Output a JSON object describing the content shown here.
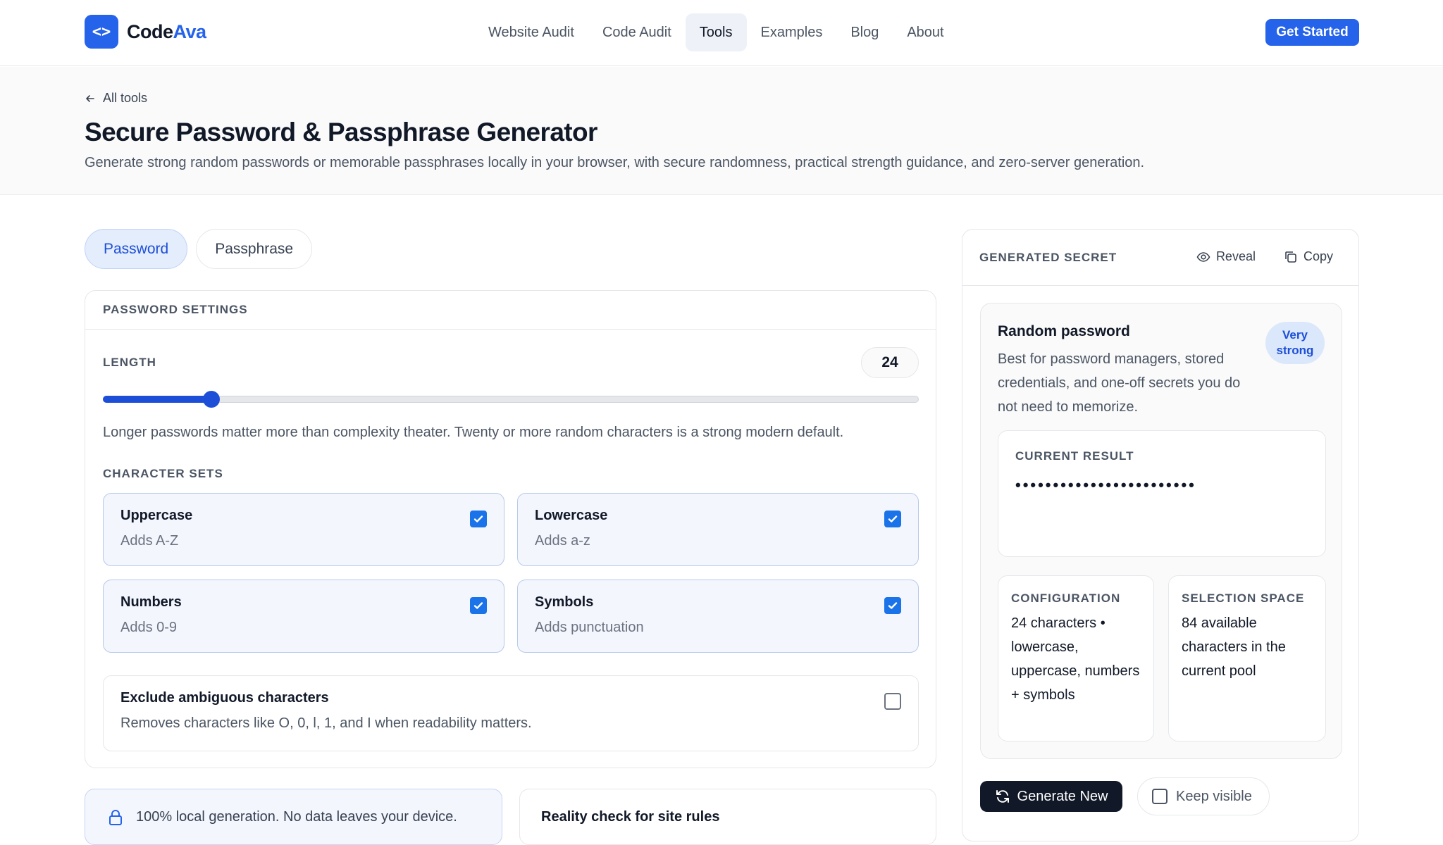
{
  "brand": {
    "name_part1": "Code",
    "name_part2": "Ava",
    "logo_glyph": "<>",
    "accent": "#2563eb"
  },
  "nav": {
    "items": [
      {
        "label": "Website Audit"
      },
      {
        "label": "Code Audit"
      },
      {
        "label": "Tools"
      },
      {
        "label": "Examples"
      },
      {
        "label": "Blog"
      },
      {
        "label": "About"
      }
    ],
    "active": "Tools",
    "cta_label": "Get Started"
  },
  "hero": {
    "back_label": "All tools",
    "title": "Secure Password & Passphrase Generator",
    "subtitle": "Generate strong random passwords or memorable passphrases locally in your browser, with secure randomness, practical strength guidance, and zero-server generation."
  },
  "tabs": [
    {
      "label": "Password"
    },
    {
      "label": "Passphrase"
    }
  ],
  "active_tab": "Password",
  "settings": {
    "heading": "PASSWORD SETTINGS",
    "length_label": "LENGTH",
    "length_value": "24",
    "length_min": 8,
    "length_max": 128,
    "length_help": "Longer passwords matter more than complexity theater. Twenty or more random characters is a strong modern default.",
    "charsets_label": "CHARACTER SETS",
    "charsets": [
      {
        "name": "Uppercase",
        "desc": "Adds A-Z",
        "checked": true
      },
      {
        "name": "Lowercase",
        "desc": "Adds a-z",
        "checked": true
      },
      {
        "name": "Numbers",
        "desc": "Adds 0-9",
        "checked": true
      },
      {
        "name": "Symbols",
        "desc": "Adds punctuation",
        "checked": true
      }
    ],
    "exclude": {
      "name": "Exclude ambiguous characters",
      "desc": "Removes characters like O, 0, l, 1, and I when readability matters.",
      "checked": false
    }
  },
  "bottom_cards": {
    "local_text": "100% local generation. No data leaves your device.",
    "reality_text": "Reality check for site rules"
  },
  "panel": {
    "title": "GENERATED SECRET",
    "reveal_label": "Reveal",
    "copy_label": "Copy",
    "result_title": "Random password",
    "result_desc": "Best for password managers, stored credentials, and one-off secrets you do not need to memorize.",
    "badge": "Very strong",
    "current_label": "CURRENT RESULT",
    "current_value": "••••••••••••••••••••••••",
    "config_label": "CONFIGURATION",
    "config_value": "24 characters • lowercase, uppercase, numbers + symbols",
    "space_label": "SELECTION SPACE",
    "space_value": "84 available characters in the current pool",
    "generate_label": "Generate New",
    "keep_label": "Keep visible"
  }
}
